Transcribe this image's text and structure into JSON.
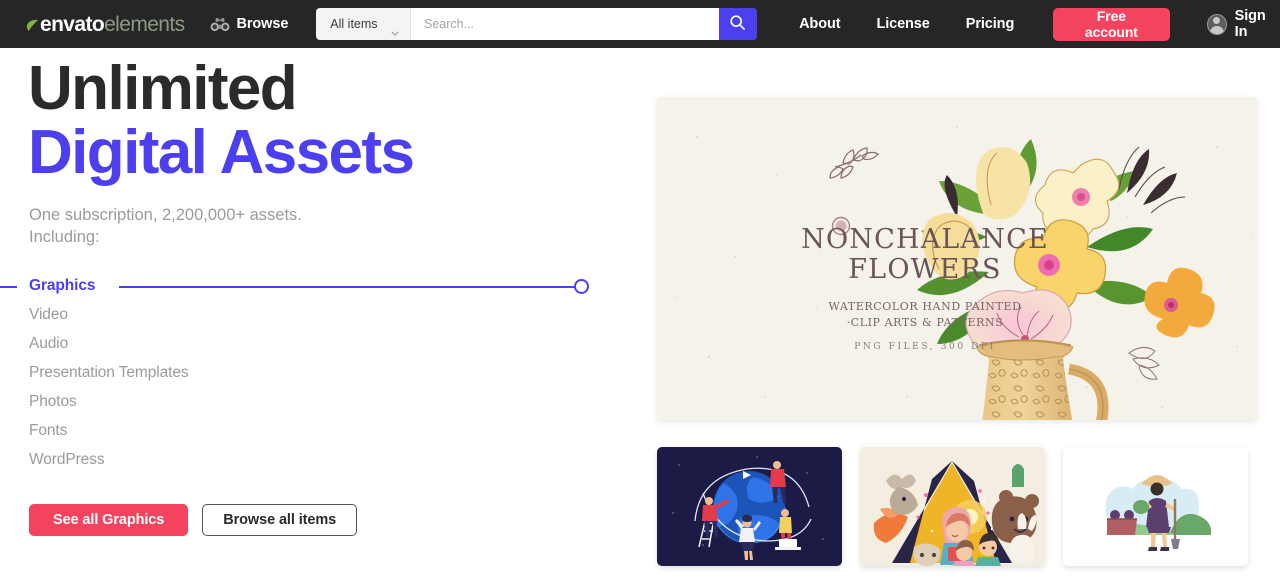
{
  "header": {
    "logo": {
      "primary": "envato",
      "secondary": "elements",
      "leaf_icon": "leaf-icon"
    },
    "browse": {
      "label": "Browse",
      "icon": "binoculars-icon"
    },
    "search": {
      "category_label": "All items",
      "chevron_icon": "chevron-down-icon",
      "placeholder": "Search...",
      "value": "",
      "button_icon": "search-icon"
    },
    "nav": [
      {
        "label": "About"
      },
      {
        "label": "License"
      },
      {
        "label": "Pricing"
      }
    ],
    "cta": {
      "label": "Free account",
      "color": "#f4435f"
    },
    "signin": {
      "label": "Sign In",
      "icon": "avatar-icon"
    },
    "background_color": "#262626"
  },
  "hero": {
    "headline_line1": "Unlimited",
    "headline_line2": "Digital Assets",
    "headline_color_1": "#2b2b2b",
    "headline_color_2": "#4b3ff0",
    "subheadline": "One subscription, 2,200,000+ assets.\nIncluding:",
    "categories": [
      {
        "label": "Graphics",
        "active": true
      },
      {
        "label": "Video",
        "active": false
      },
      {
        "label": "Audio",
        "active": false
      },
      {
        "label": "Presentation Templates",
        "active": false
      },
      {
        "label": "Photos",
        "active": false
      },
      {
        "label": "Fonts",
        "active": false
      },
      {
        "label": "WordPress",
        "active": false
      }
    ],
    "buttons": {
      "primary": "See all Graphics",
      "secondary": "Browse all items"
    },
    "accent_color": "#4b3ff0"
  },
  "showcase": {
    "featured": {
      "name": "nonchalance-flowers-card",
      "title": "NONCHALANCE\nFLOWERS",
      "subtitle": "WATERCOLOR HAND PAINTED\n·CLIP ARTS & PATTERNS",
      "format_note": "PNG FILES, 300 DPI",
      "background_color": "#f4f1ea",
      "text_color": "#6b5458"
    },
    "thumbnails": [
      {
        "name": "global-teamwork-illustration",
        "background_color": "#1b1b46"
      },
      {
        "name": "children-animals-storybook-illustration",
        "background_color": "#f2ece2"
      },
      {
        "name": "gardener-woman-illustration",
        "background_color": "#ffffff"
      }
    ]
  }
}
